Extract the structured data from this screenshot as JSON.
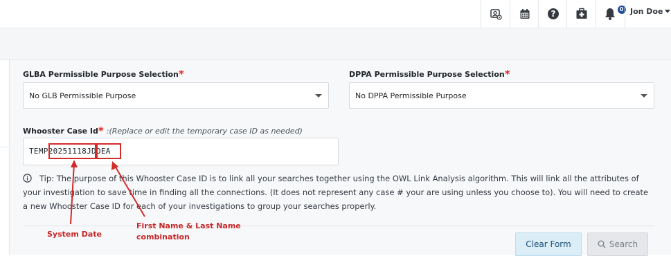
{
  "header": {
    "user_name": "Jon Doe",
    "notification_count": "0",
    "icons": [
      "id-card-gear-icon",
      "calendar-icon",
      "help-icon",
      "medical-kit-icon",
      "bell-icon"
    ]
  },
  "form": {
    "glba": {
      "label": "GLBA Permissible Purpose Selection",
      "required_mark": "*",
      "selected": "No GLB Permissible Purpose"
    },
    "dppa": {
      "label": "DPPA Permissible Purpose Selection",
      "required_mark": "*",
      "selected": "No DPPA Permissible Purpose"
    },
    "case_id": {
      "label": "Whooster Case Id",
      "required_mark": "*",
      "hint": ":(Replace or edit the temporary case ID as needed)",
      "value": "TEMP20251118JDOEA"
    },
    "tip": "Tip: The purpose of this Whooster Case ID is to link all your searches together using the OWL Link Analysis algorithm. This will link all the attributes of your investigation to save time in finding all the connections. (It does not represent any case # your are using unless you choose to). You will need to create a new Whooster Case ID for each of your investigations to group your searches properly."
  },
  "buttons": {
    "clear": "Clear Form",
    "search": "Search"
  },
  "annotations": {
    "system_date": "System Date",
    "name_combo_line1": "First Name & Last Name",
    "name_combo_line2": "combination"
  },
  "colors": {
    "accent_red": "#d42a2a",
    "required_red": "#e02424",
    "badge_blue": "#1f4e9a",
    "clear_button_bg": "#dbeef8"
  }
}
